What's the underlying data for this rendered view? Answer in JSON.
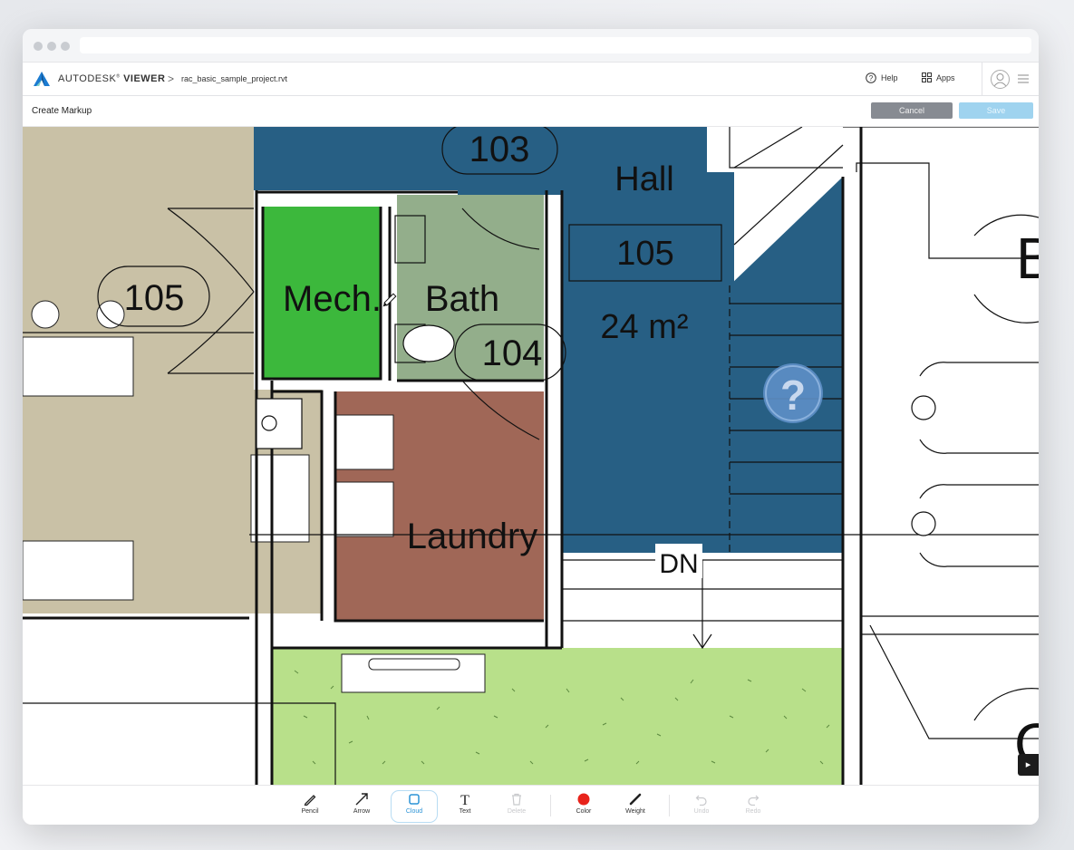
{
  "app": {
    "brand_name": "AUTODESK",
    "brand_product": "VIEWER",
    "breadcrumb_sep": ">",
    "filename": "rac_basic_sample_project.rvt",
    "help_label": "Help",
    "apps_label": "Apps"
  },
  "markup": {
    "title": "Create Markup",
    "cancel_label": "Cancel",
    "save_label": "Save"
  },
  "drawing": {
    "rooms": {
      "r103": "103",
      "hall": "Hall",
      "r105_right": "105",
      "area": "24 m²",
      "r105_left": "105",
      "mech": "Mech.",
      "bath": "Bath",
      "r104": "104",
      "laundry": "Laundry",
      "dn": "DN",
      "edge_b": "B",
      "edge_c": "C"
    },
    "help_marker": "?",
    "colors": {
      "tan": "#c9c1a6",
      "hall_blue": "#275f84",
      "mech_green": "#3cb83c",
      "bath_sage": "#93ae8b",
      "laundry_brown": "#a06757",
      "lawn": "#b8e08a"
    }
  },
  "toolbar": {
    "tools": [
      {
        "label": "Pencil",
        "icon": "pencil-icon",
        "state": "normal"
      },
      {
        "label": "Arrow",
        "icon": "arrow-icon",
        "state": "normal"
      },
      {
        "label": "Cloud",
        "icon": "cloud-icon",
        "state": "active"
      },
      {
        "label": "Text",
        "icon": "text-icon",
        "state": "normal"
      },
      {
        "label": "Delete",
        "icon": "trash-icon",
        "state": "disabled"
      },
      {
        "label": "Color",
        "icon": "color-dot-icon",
        "state": "normal"
      },
      {
        "label": "Weight",
        "icon": "weight-icon",
        "state": "normal"
      },
      {
        "label": "Undo",
        "icon": "undo-icon",
        "state": "disabled"
      },
      {
        "label": "Redo",
        "icon": "redo-icon",
        "state": "disabled"
      }
    ],
    "accent_color": "#2b93d6",
    "color_value": "#e8231b"
  }
}
